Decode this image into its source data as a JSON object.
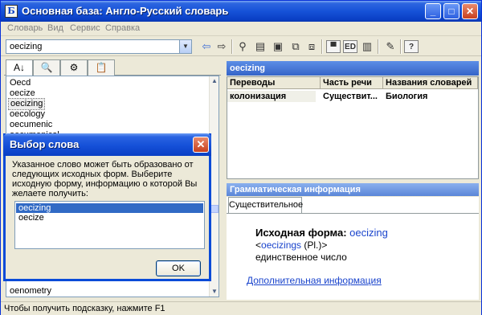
{
  "window": {
    "title": "Основная база: Англо-Русский словарь",
    "minimize": "_",
    "maximize": "□",
    "close": "✕"
  },
  "menu": [
    "Словарь",
    "Вид",
    "Сервис",
    "Справка"
  ],
  "toolbar": {
    "search_value": "oecizing",
    "dropdown_arrow": "▼",
    "edit_badge": "ED"
  },
  "left_tabs": [
    "A↓",
    "🔍",
    "⚙",
    "📋"
  ],
  "word_list": [
    "Oecd",
    "oecize",
    "oecizing",
    "oecology",
    "oecumenic",
    "oecumenical",
    "oenometry"
  ],
  "right_panel": {
    "header": "oecizing",
    "columns": [
      "Переводы",
      "Часть речи",
      "Названия словарей"
    ],
    "rows": [
      [
        "колонизация",
        "Существит...",
        "Биология"
      ]
    ]
  },
  "grammar": {
    "header": "Грамматическая информация",
    "tab": "Существительное",
    "base_label": "Исходная форма:",
    "base_value": "oecizing",
    "plural_open": "<",
    "plural_word": "oecizings",
    "plural_suffix": " (Pl.)>",
    "number": "единственное число",
    "more_link": "Дополнительная информация"
  },
  "dialog": {
    "title": "Выбор слова",
    "message": "Указанное слово может быть образовано от следующих исходных форм. Выберите исходную форму, информацию о которой Вы желаете получить:",
    "options": [
      "oecizing",
      "oecize"
    ],
    "ok": "OK",
    "close": "✕"
  },
  "status": "Чтобы получить подсказку, нажмите F1"
}
